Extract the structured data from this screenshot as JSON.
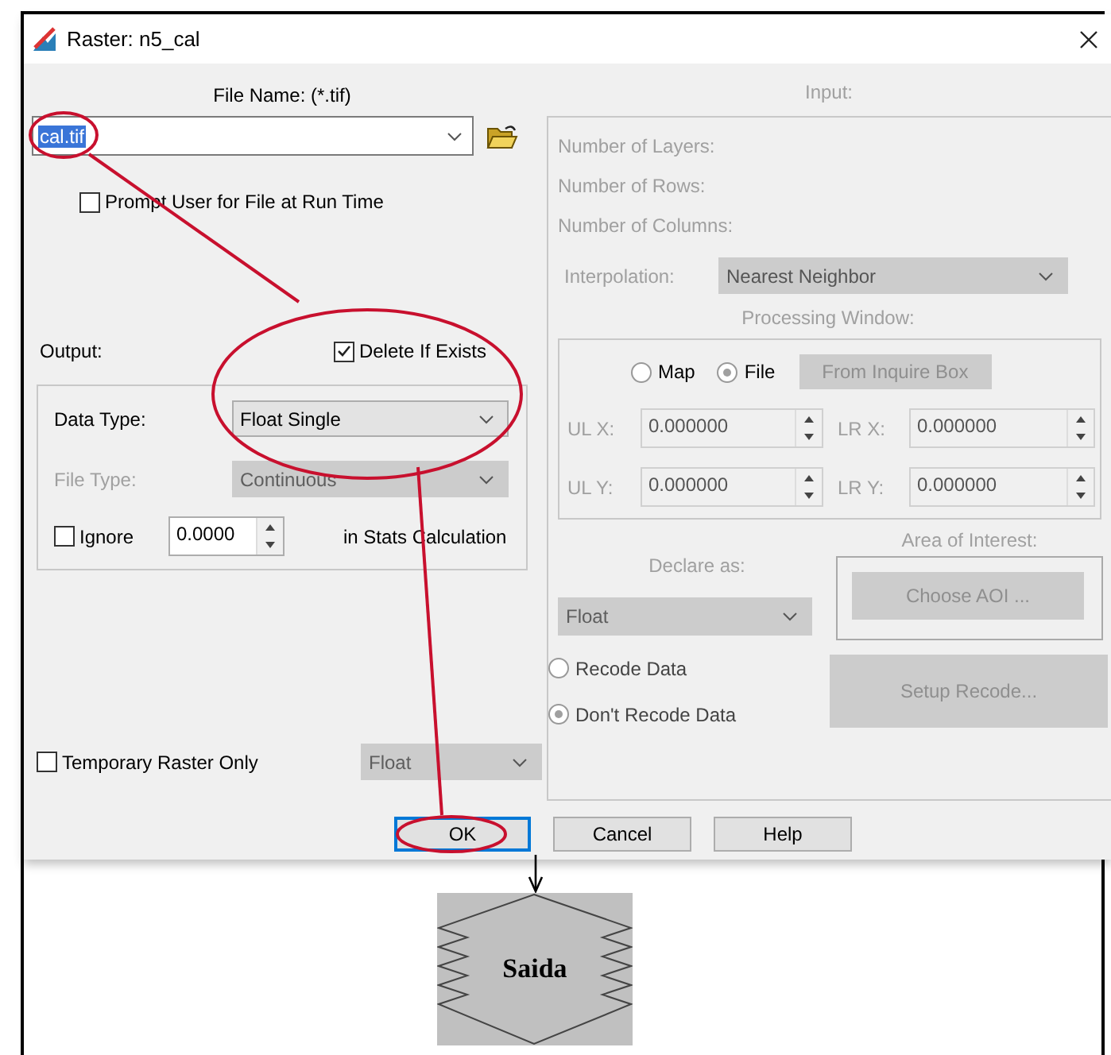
{
  "window": {
    "title": "Raster:  n5_cal"
  },
  "file_name": {
    "label": "File Name: (*.tif)",
    "value": "cal.tif"
  },
  "prompt_user": {
    "label": "Prompt User for File at Run Time",
    "checked": false
  },
  "output": {
    "label": "Output:",
    "delete_if_exists": {
      "label": "Delete If Exists",
      "checked": true
    },
    "fields": [
      {
        "label": "Data Type:",
        "value": "Float Single",
        "disabled": false
      },
      {
        "label": "File Type:",
        "value": "Continuous",
        "disabled": true
      }
    ],
    "ignore": {
      "label": "Ignore",
      "checked": false,
      "value": "0.0000",
      "suffix": "in Stats Calculation"
    }
  },
  "temporary": {
    "label": "Temporary Raster Only",
    "checked": false,
    "type_value": "Float",
    "disabled": true
  },
  "input": {
    "title": "Input:",
    "disabled": true,
    "info": [
      "Number of Layers:",
      "Number of Rows:",
      "Number of Columns:"
    ],
    "interpolation": {
      "label": "Interpolation:",
      "value": "Nearest Neighbor"
    },
    "processing_window": {
      "title": "Processing Window:",
      "modes": [
        {
          "label": "Map",
          "selected": false
        },
        {
          "label": "File",
          "selected": true
        }
      ],
      "inquire_button": "From Inquire Box",
      "coords": [
        {
          "label": "UL X:",
          "value": "0.000000"
        },
        {
          "label": "LR X:",
          "value": "0.000000"
        },
        {
          "label": "UL Y:",
          "value": "0.000000"
        },
        {
          "label": "LR Y:",
          "value": "0.000000"
        }
      ]
    },
    "declare_as": {
      "label": "Declare as:",
      "value": "Float"
    },
    "aoi": {
      "label": "Area of Interest:",
      "button": "Choose AOI ..."
    },
    "recode": [
      {
        "label": "Recode Data",
        "selected": false
      },
      {
        "label": "Don't Recode Data",
        "selected": true
      }
    ],
    "setup_button": "Setup Recode..."
  },
  "buttons": [
    {
      "label": "OK",
      "default": true
    },
    {
      "label": "Cancel",
      "default": false
    },
    {
      "label": "Help",
      "default": false
    }
  ],
  "diagram": {
    "node": "Saida"
  }
}
